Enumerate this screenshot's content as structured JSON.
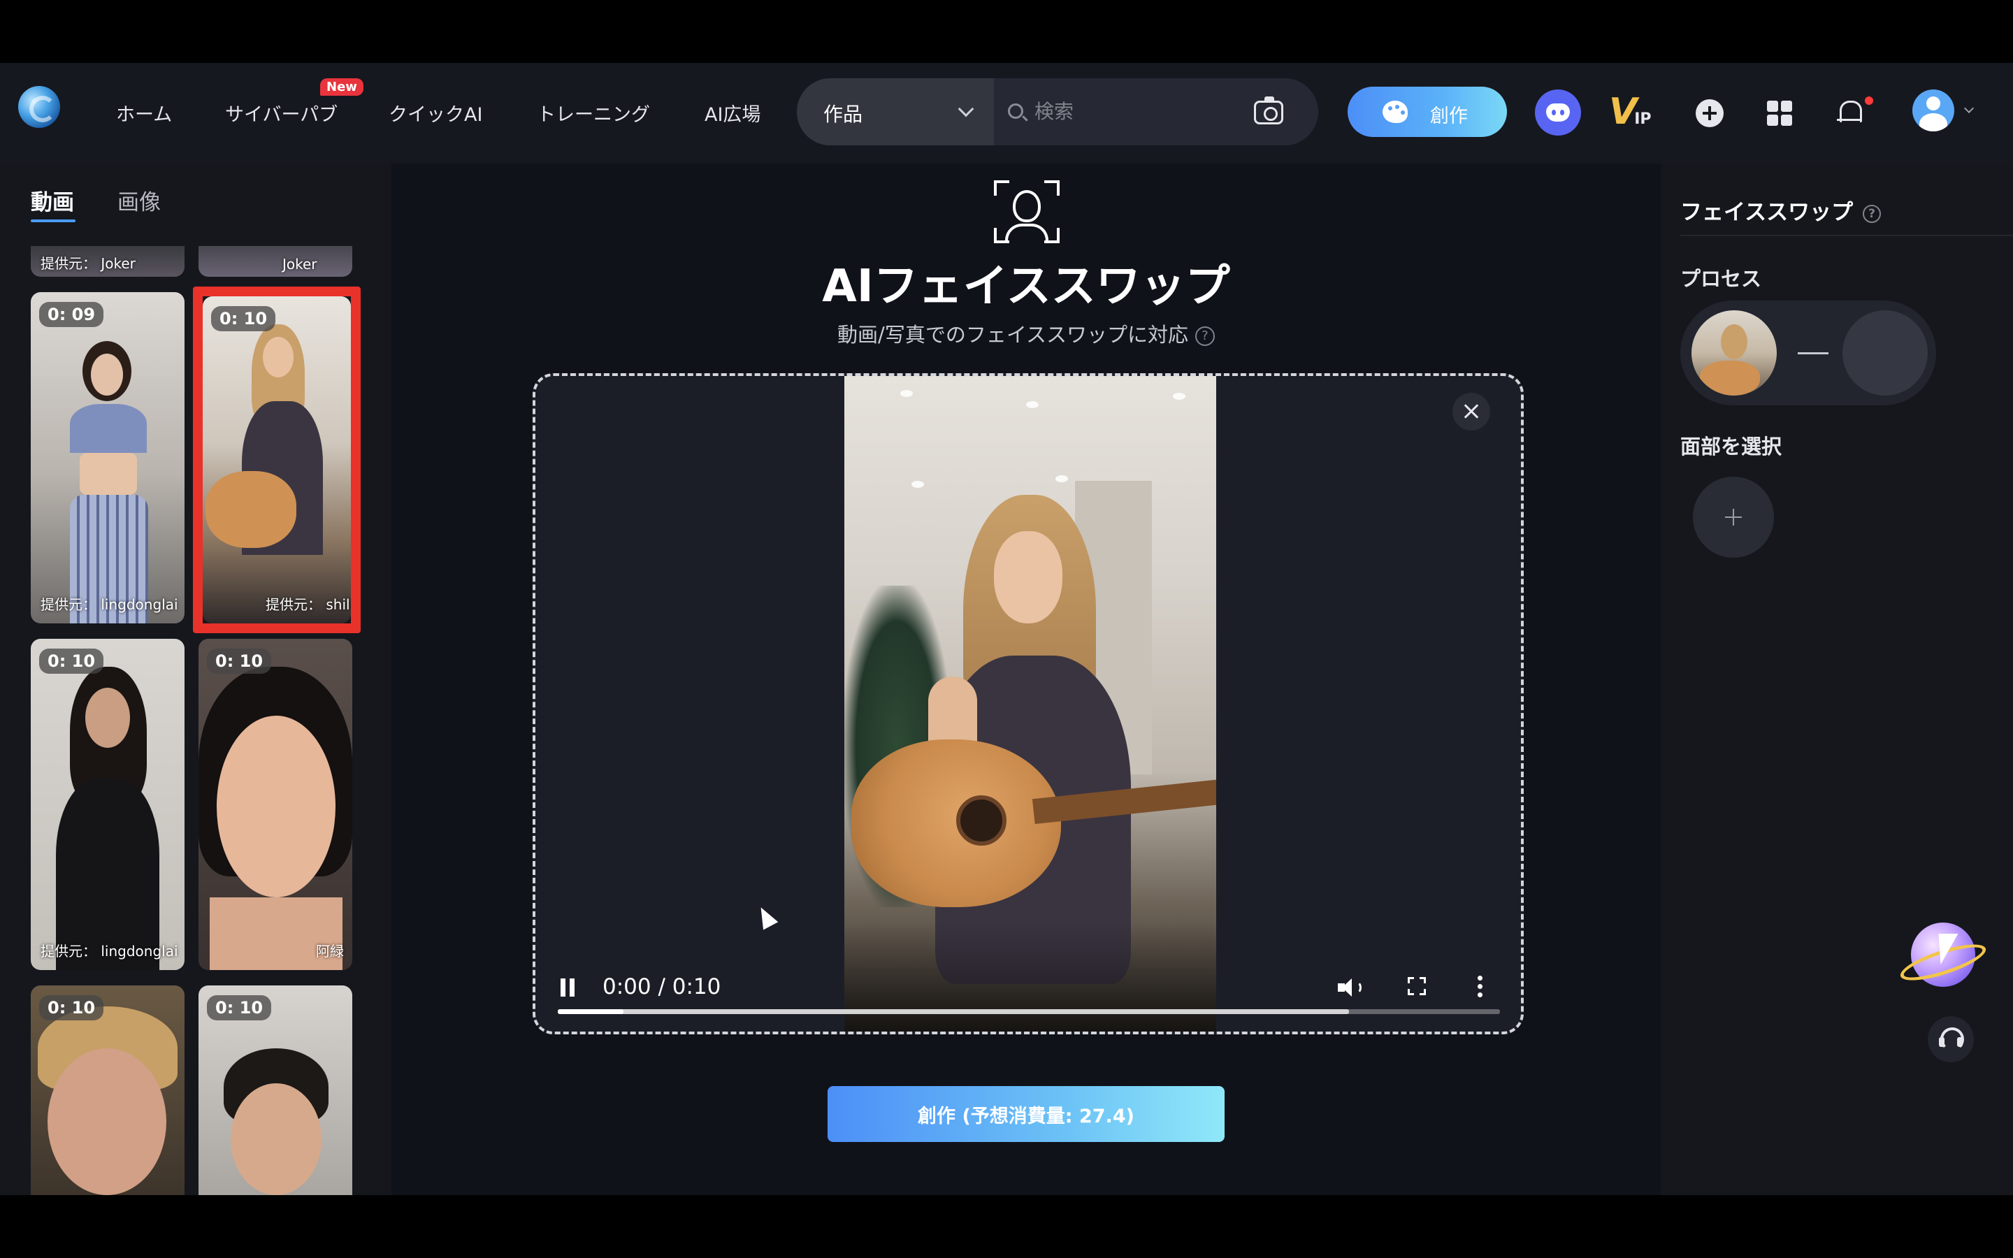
{
  "header": {
    "nav": [
      {
        "label": "ホーム"
      },
      {
        "label": "サイバーパブ",
        "badge": "New"
      },
      {
        "label": "クイックAI"
      },
      {
        "label": "トレーニング"
      },
      {
        "label": "AI広場"
      }
    ],
    "search": {
      "category": "作品",
      "placeholder": "検索"
    },
    "create_label": "創作",
    "vip_label": "V",
    "vip_sub": "IP",
    "icons": [
      "discord-icon",
      "vip-icon",
      "plus-icon",
      "grid-icon",
      "bell-icon",
      "avatar"
    ]
  },
  "left_panel": {
    "tabs": [
      {
        "label": "動画",
        "active": true
      },
      {
        "label": "画像",
        "active": false
      }
    ],
    "items": [
      {
        "duration": "0: 09",
        "caption": "提供元： lingdonglai"
      },
      {
        "duration": "0: 10",
        "caption": "提供元： shili",
        "selected": true
      },
      {
        "duration": "0: 10",
        "caption": "提供元： lingdonglai"
      },
      {
        "duration": "0: 10",
        "caption": "阿緑"
      },
      {
        "duration": "0: 10",
        "caption": ""
      },
      {
        "duration": "0: 10",
        "caption": ""
      }
    ],
    "partial_top_captions": [
      "提供元： Joker",
      "Joker"
    ]
  },
  "main": {
    "title": "AIフェイススワップ",
    "subtitle": "動画/写真でのフェイススワップに対応",
    "help_glyph": "?",
    "video": {
      "time": "0:00 / 0:10",
      "played_fraction": 0.07,
      "buffered_fraction": 0.84
    },
    "create_button": "創作 (予想消費量: 27.4)"
  },
  "right_panel": {
    "title": "フェイススワップ",
    "process_label": "プロセス",
    "select_face_label": "面部を選択"
  },
  "colors": {
    "accent_blue": "#4c8ff7",
    "selected_border": "#e8322a",
    "new_badge": "#e8343c",
    "background": "#10121a"
  }
}
